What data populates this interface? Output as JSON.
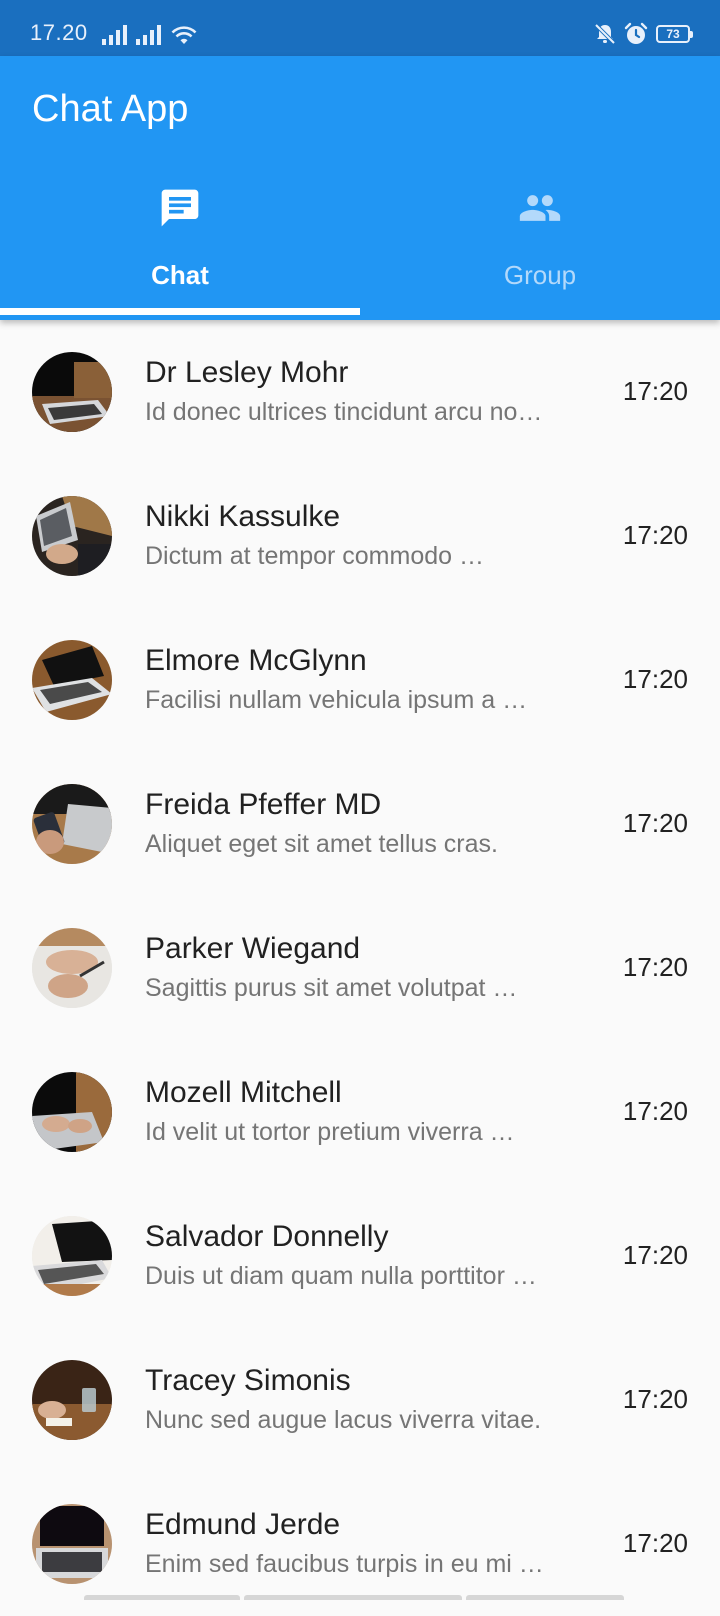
{
  "status_bar": {
    "time": "17.20",
    "battery": "73",
    "icons": [
      "signal-icon",
      "signal-icon",
      "wifi-icon",
      "muted-notification-icon",
      "alarm-icon",
      "battery-icon"
    ]
  },
  "app": {
    "title": "Chat App",
    "accent_color": "#2196f3",
    "status_bar_color": "#1a6fbf"
  },
  "tabs": [
    {
      "label": "Chat",
      "icon": "chat-icon",
      "selected": true
    },
    {
      "label": "Group",
      "icon": "group-icon",
      "selected": false
    }
  ],
  "chats": [
    {
      "name": "Dr Lesley Mohr",
      "preview": "Id donec ultrices tincidunt arcu no…",
      "time": "17:20",
      "avatar": "laptop-photo-avatar"
    },
    {
      "name": "Nikki Kassulke",
      "preview": "Dictum at tempor commodo …",
      "time": "17:20",
      "avatar": "laptop-photo-avatar"
    },
    {
      "name": "Elmore McGlynn",
      "preview": "Facilisi nullam vehicula ipsum a …",
      "time": "17:20",
      "avatar": "laptop-photo-avatar"
    },
    {
      "name": "Freida Pfeffer MD",
      "preview": "Aliquet eget sit amet tellus cras.",
      "time": "17:20",
      "avatar": "phone-laptop-photo-avatar"
    },
    {
      "name": "Parker Wiegand",
      "preview": "Sagittis purus sit amet volutpat …",
      "time": "17:20",
      "avatar": "hands-writing-photo-avatar"
    },
    {
      "name": "Mozell Mitchell",
      "preview": "Id velit ut tortor pretium viverra …",
      "time": "17:20",
      "avatar": "laptop-photo-avatar"
    },
    {
      "name": "Salvador Donnelly",
      "preview": "Duis ut diam quam nulla porttitor …",
      "time": "17:20",
      "avatar": "laptop-photo-avatar"
    },
    {
      "name": "Tracey Simonis",
      "preview": "Nunc sed augue lacus viverra vitae.",
      "time": "17:20",
      "avatar": "desk-photo-avatar"
    },
    {
      "name": "Edmund Jerde",
      "preview": "Enim sed faucibus turpis in eu mi …",
      "time": "17:20",
      "avatar": "keyboard-photo-avatar"
    }
  ]
}
